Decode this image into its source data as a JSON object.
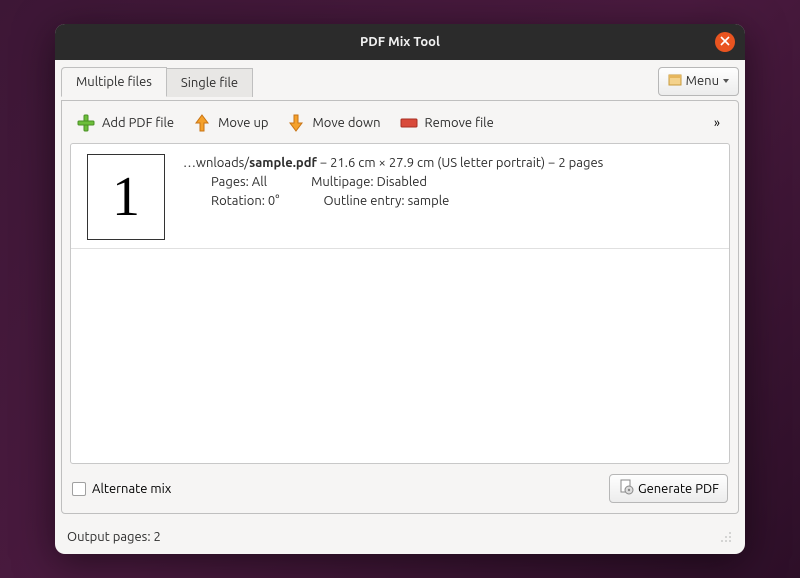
{
  "window": {
    "title": "PDF Mix Tool"
  },
  "tabs": {
    "multiple": "Multiple files",
    "single": "Single file"
  },
  "menu": {
    "label": "Menu"
  },
  "toolbar": {
    "add": "Add PDF file",
    "moveup": "Move up",
    "movedown": "Move down",
    "remove": "Remove file"
  },
  "file": {
    "thumb": "1",
    "pathPrefix": "…wnloads/",
    "name": "sample.pdf",
    "dims": " − 21.6 cm × 27.9 cm (US letter portrait) − 2 pages",
    "pagesLabel": "Pages: All",
    "multipage": "Multipage: Disabled",
    "rotation": "Rotation: 0°",
    "outline": "Outline entry: sample"
  },
  "bottom": {
    "alternate": "Alternate mix",
    "generate": "Generate PDF"
  },
  "status": "Output pages: 2"
}
